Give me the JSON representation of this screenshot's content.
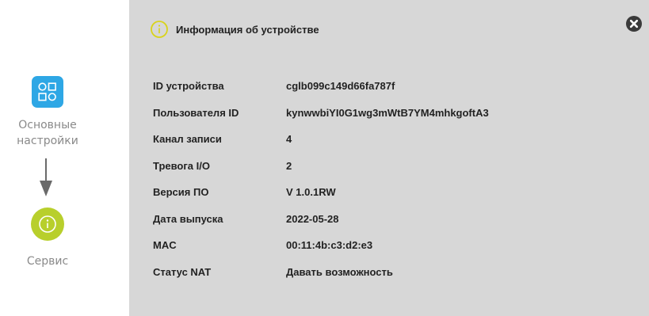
{
  "sidebar": {
    "steps": [
      {
        "label": "Основные\nнастройки",
        "icon": "grid-settings-icon",
        "color": "#2ea7e5"
      },
      {
        "label": "Сервис",
        "icon": "info-icon",
        "color": "#b8cf2c"
      }
    ]
  },
  "panel": {
    "title": "Информация об устройстве",
    "close_icon": "close-icon",
    "rows": [
      {
        "label": "ID устройства",
        "value": "cglb099c149d66fa787f"
      },
      {
        "label": "Пользователя ID",
        "value": "kynwwbiYI0G1wg3mWtB7YM4mhkgoftA3"
      },
      {
        "label": "Канал записи",
        "value": "4"
      },
      {
        "label": "Тревога I/O",
        "value": "2"
      },
      {
        "label": "Версия ПО",
        "value": "V 1.0.1RW"
      },
      {
        "label": "Дата выпуска",
        "value": "2022-05-28"
      },
      {
        "label": "MAC",
        "value": "00:11:4b:c3:d2:e3"
      },
      {
        "label": "Статус NAT",
        "value": "Давать возможность"
      }
    ]
  },
  "colors": {
    "panel_bg": "#d7d7d7",
    "accent_blue": "#2ea7e5",
    "accent_green": "#b8cf2c"
  }
}
